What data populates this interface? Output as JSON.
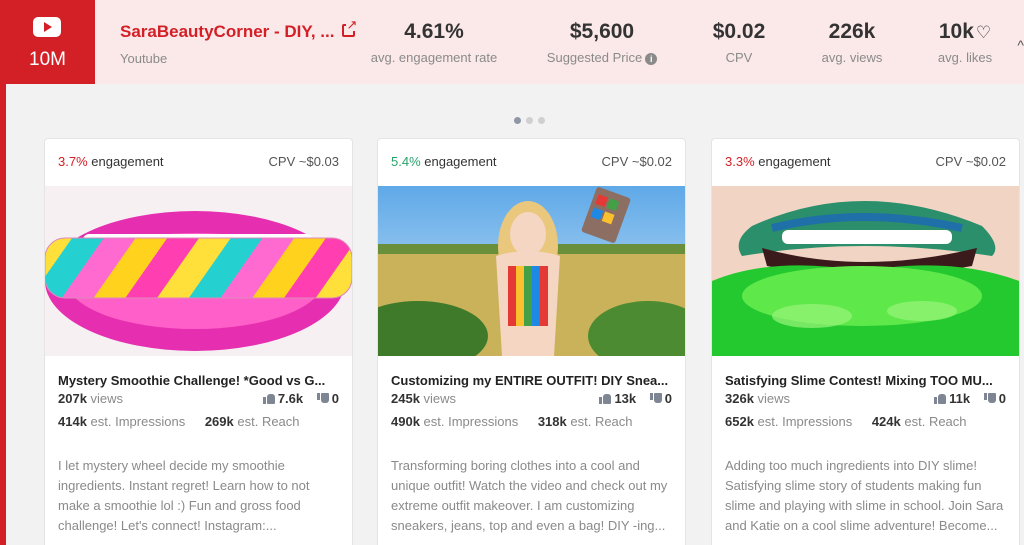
{
  "colors": {
    "brand_red": "#d32027",
    "header_bg": "#fbe9e9",
    "engagement_green": "#2aa36a"
  },
  "channel": {
    "subscribers": "10M",
    "name": "SaraBeautyCorner - DIY, ...",
    "platform": "Youtube",
    "platform_icon": "youtube-icon",
    "link_icon": "external-link-icon"
  },
  "stats": {
    "engagement": {
      "value": "4.61%",
      "label": "avg. engagement rate"
    },
    "price": {
      "value": "$5,600",
      "label": "Suggested Price"
    },
    "cpv": {
      "value": "$0.02",
      "label": "CPV"
    },
    "views": {
      "value": "226k",
      "label": "avg. views"
    },
    "likes": {
      "value": "10k",
      "label": "avg. likes"
    }
  },
  "carousel": {
    "pages": 3,
    "active": 0
  },
  "cards": [
    {
      "engagement_pct": "3.7%",
      "engagement_label": "engagement",
      "cpv": "CPV ~$0.03",
      "title": "Mystery Smoothie Challenge! *Good vs G...",
      "views": "207k",
      "views_label": "views",
      "likes": "7.6k",
      "dislikes": "0",
      "impressions": "414k",
      "impressions_label": "est. Impressions",
      "reach": "269k",
      "reach_label": "est. Reach",
      "description": "I let mystery wheel decide my smoothie ingredients. Instant regret! Learn how to not make a smoothie lol :) Fun and gross food challenge! Let's connect! Instagram:..."
    },
    {
      "engagement_pct": "5.4%",
      "engagement_label": "engagement",
      "cpv": "CPV ~$0.02",
      "title": "Customizing my ENTIRE OUTFIT! DIY Snea...",
      "views": "245k",
      "views_label": "views",
      "likes": "13k",
      "dislikes": "0",
      "impressions": "490k",
      "impressions_label": "est. Impressions",
      "reach": "318k",
      "reach_label": "est. Reach",
      "description": "Transforming boring clothes into a cool and unique outfit! Watch the video and check out my extreme outfit makeover. I am customizing sneakers, jeans, top and even a bag! DIY -ing..."
    },
    {
      "engagement_pct": "3.3%",
      "engagement_label": "engagement",
      "cpv": "CPV ~$0.02",
      "title": "Satisfying Slime Contest! Mixing TOO MU...",
      "views": "326k",
      "views_label": "views",
      "likes": "11k",
      "dislikes": "0",
      "impressions": "652k",
      "impressions_label": "est. Impressions",
      "reach": "424k",
      "reach_label": "est. Reach",
      "description": "Adding too much ingredients into DIY slime! Satisfying slime story of students making fun slime and playing with slime in school. Join Sara and Katie on a cool slime adventure! Become..."
    }
  ]
}
